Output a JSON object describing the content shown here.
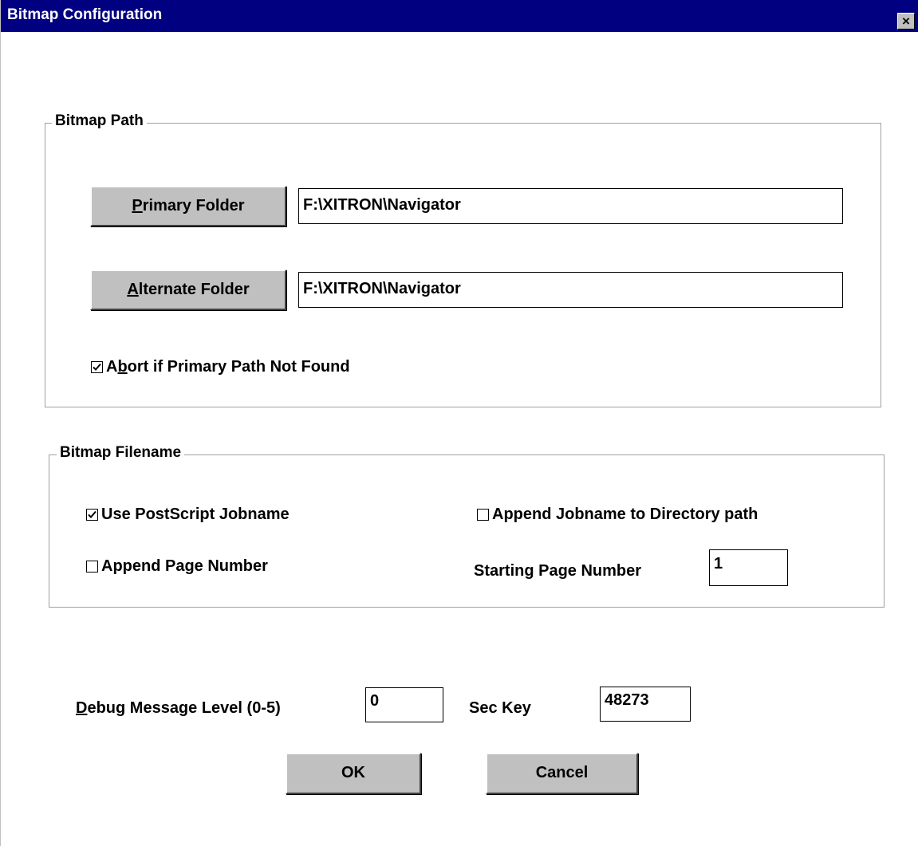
{
  "window": {
    "title": "Bitmap Configuration",
    "close_glyph": "✕"
  },
  "bitmap_path": {
    "label": "Bitmap Path",
    "primary_button": {
      "mnemonic": "P",
      "rest": "rimary Folder"
    },
    "primary_value": "F:\\XITRON\\Navigator",
    "alternate_button": {
      "mnemonic": "A",
      "rest": "lternate Folder"
    },
    "alternate_value": "F:\\XITRON\\Navigator",
    "abort_checkbox": {
      "pre": "A",
      "mnemonic": "b",
      "rest": "ort if Primary Path Not Found",
      "checked": true
    }
  },
  "bitmap_filename": {
    "label": "Bitmap Filename",
    "use_jobname": {
      "label": "Use PostScript Jobname",
      "checked": true
    },
    "append_jobname_dir": {
      "label": "Append Jobname to Directory path",
      "checked": false
    },
    "append_page_number": {
      "label": "Append Page Number",
      "checked": false
    },
    "starting_page_label": "Starting Page Number",
    "starting_page_value": "1"
  },
  "debug": {
    "label_mnemonic": "D",
    "label_rest": "ebug Message Level (0-5)",
    "value": "0"
  },
  "sec_key": {
    "label": "Sec Key",
    "value": "48273"
  },
  "buttons": {
    "ok": "OK",
    "cancel": "Cancel"
  },
  "icons": {
    "close": "close-icon",
    "check": "checkmark-icon"
  }
}
